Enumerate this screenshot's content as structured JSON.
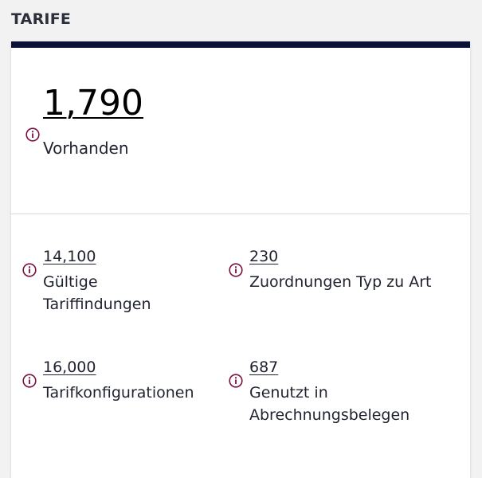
{
  "section": {
    "title": "TARIFE"
  },
  "primary": {
    "value": "1,790",
    "label": "Vorhanden",
    "icon": "info-icon"
  },
  "metrics": [
    {
      "value": "14,100",
      "label": "Gültige Tariffindungen",
      "icon": "info-icon"
    },
    {
      "value": "230",
      "label": "Zuordnungen Typ zu Art",
      "icon": "info-icon"
    },
    {
      "value": "16,000",
      "label": "Tarifkonfigurationen",
      "icon": "info-icon"
    },
    {
      "value": "687",
      "label": "Genutzt in Abrechnungsbelegen",
      "icon": "info-icon"
    }
  ],
  "colors": {
    "accent_bar": "#0b1235",
    "info_icon": "#7a1040"
  }
}
